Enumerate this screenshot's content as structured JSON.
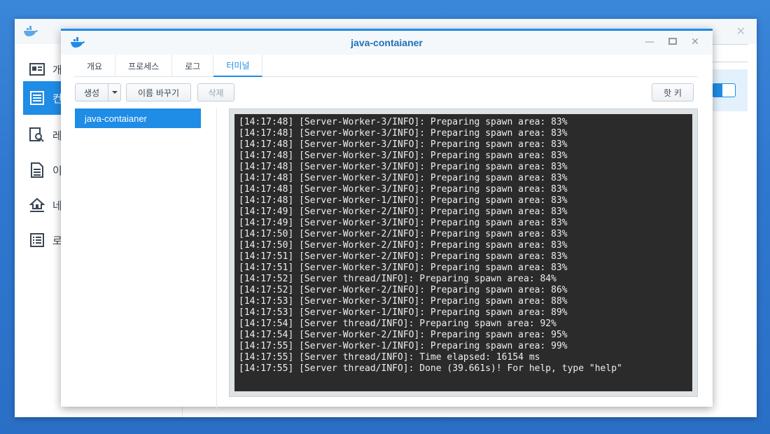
{
  "background_app": {
    "sidebar": {
      "items": [
        {
          "label": "개요",
          "icon": "overview-card-icon",
          "active": false
        },
        {
          "label": "컨테이너",
          "icon": "container-list-icon",
          "active": true
        },
        {
          "label": "레지스트리",
          "icon": "registry-search-icon",
          "active": false
        },
        {
          "label": "이미지",
          "icon": "image-doc-icon",
          "active": false
        },
        {
          "label": "네트워크",
          "icon": "network-house-icon",
          "active": false
        },
        {
          "label": "로그",
          "icon": "log-list-icon",
          "active": false
        }
      ]
    }
  },
  "dialog": {
    "title": "java-contaianer",
    "tabs": [
      {
        "label": "개요",
        "active": false
      },
      {
        "label": "프로세스",
        "active": false
      },
      {
        "label": "로그",
        "active": false
      },
      {
        "label": "터미널",
        "active": true
      }
    ],
    "toolbar": {
      "create_label": "생성",
      "rename_label": "이름 바꾸기",
      "delete_label": "삭제",
      "hotkey_label": "핫 키"
    },
    "sessions": [
      "java-contaianer"
    ],
    "terminal_lines": [
      "[14:17:48] [Server-Worker-3/INFO]: Preparing spawn area: 83%",
      "[14:17:48] [Server-Worker-3/INFO]: Preparing spawn area: 83%",
      "[14:17:48] [Server-Worker-3/INFO]: Preparing spawn area: 83%",
      "[14:17:48] [Server-Worker-3/INFO]: Preparing spawn area: 83%",
      "[14:17:48] [Server-Worker-3/INFO]: Preparing spawn area: 83%",
      "[14:17:48] [Server-Worker-3/INFO]: Preparing spawn area: 83%",
      "[14:17:48] [Server-Worker-3/INFO]: Preparing spawn area: 83%",
      "[14:17:48] [Server-Worker-1/INFO]: Preparing spawn area: 83%",
      "[14:17:49] [Server-Worker-2/INFO]: Preparing spawn area: 83%",
      "[14:17:49] [Server-Worker-3/INFO]: Preparing spawn area: 83%",
      "[14:17:50] [Server-Worker-2/INFO]: Preparing spawn area: 83%",
      "[14:17:50] [Server-Worker-2/INFO]: Preparing spawn area: 83%",
      "[14:17:51] [Server-Worker-2/INFO]: Preparing spawn area: 83%",
      "[14:17:51] [Server-Worker-3/INFO]: Preparing spawn area: 83%",
      "[14:17:52] [Server thread/INFO]: Preparing spawn area: 84%",
      "[14:17:52] [Server-Worker-2/INFO]: Preparing spawn area: 86%",
      "[14:17:53] [Server-Worker-3/INFO]: Preparing spawn area: 88%",
      "[14:17:53] [Server-Worker-1/INFO]: Preparing spawn area: 89%",
      "[14:17:54] [Server thread/INFO]: Preparing spawn area: 92%",
      "[14:17:54] [Server-Worker-2/INFO]: Preparing spawn area: 95%",
      "[14:17:55] [Server-Worker-1/INFO]: Preparing spawn area: 99%",
      "[14:17:55] [Server thread/INFO]: Time elapsed: 16154 ms",
      "[14:17:55] [Server thread/INFO]: Done (39.661s)! For help, type \"help\""
    ]
  },
  "colors": {
    "accent": "#1f8ce6",
    "title": "#1f6fb8",
    "terminal_bg": "#2b2b2b",
    "terminal_fg": "#eeeeee",
    "desktop": "#2f78cf"
  }
}
